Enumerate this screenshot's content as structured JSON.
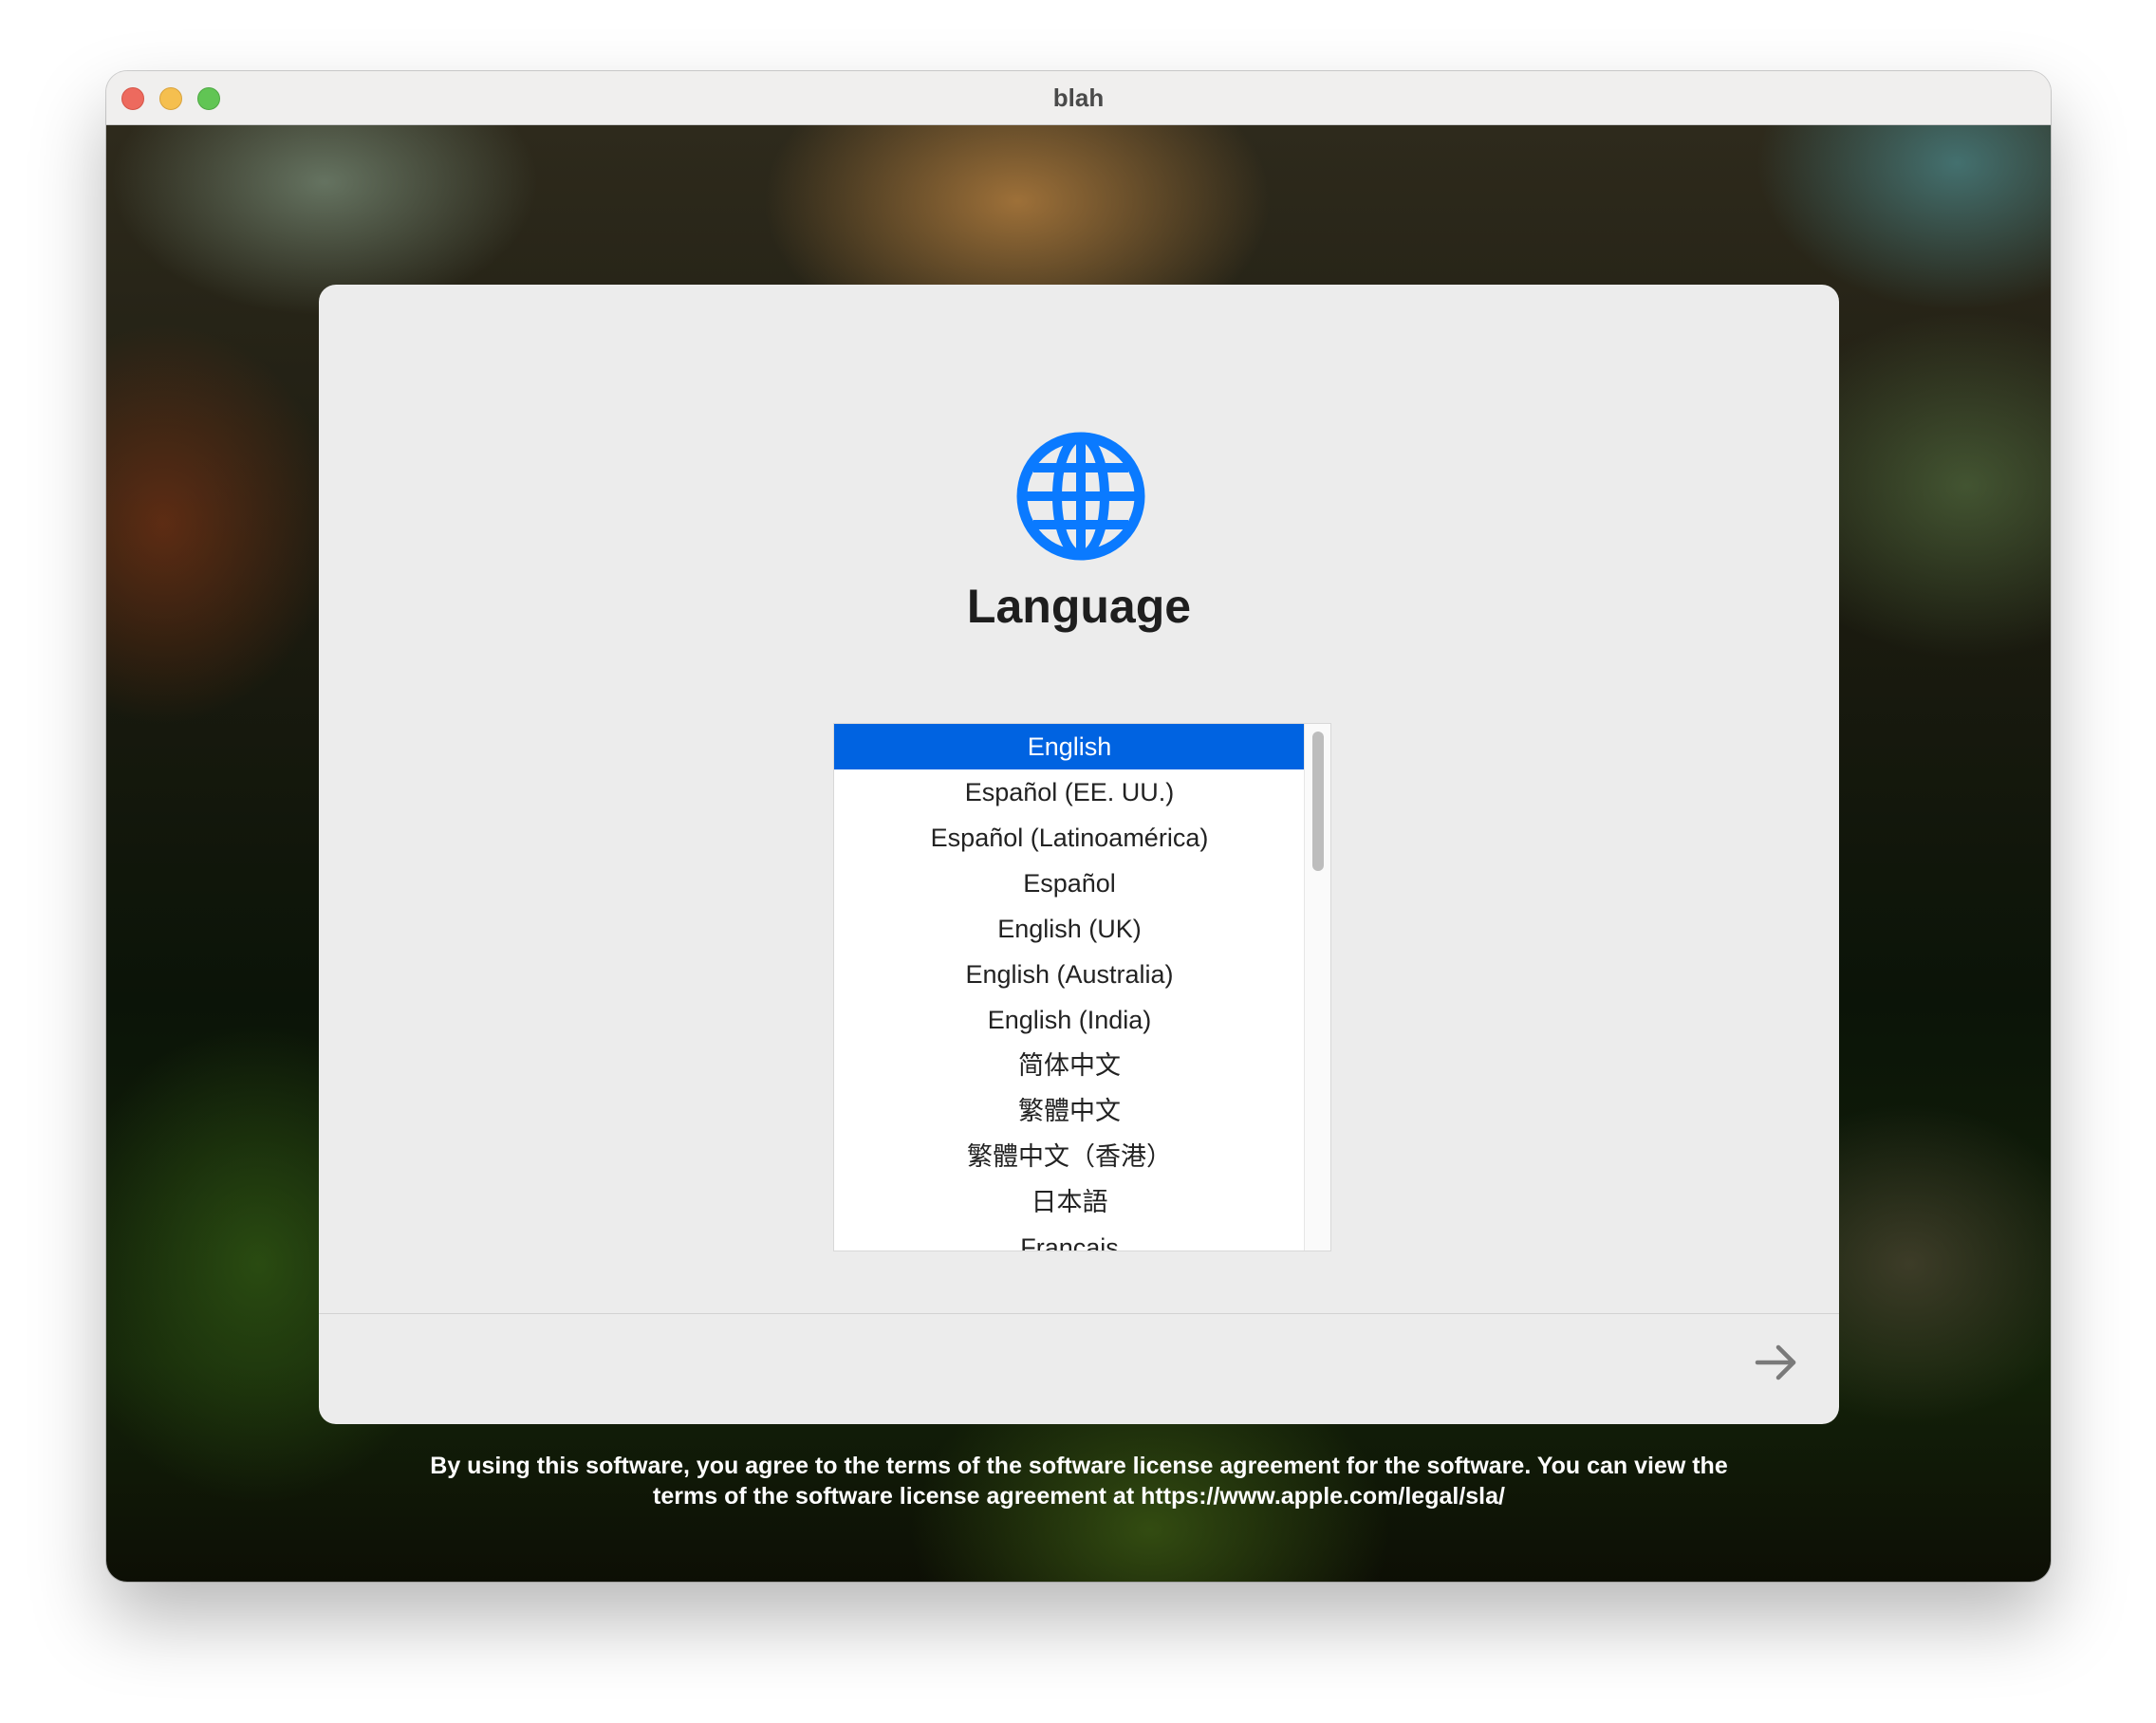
{
  "window": {
    "title": "blah",
    "traffic_lights": {
      "close": "#ed6a5e",
      "minimize": "#f5bf4f",
      "maximize": "#61c554"
    }
  },
  "setup": {
    "icon": "globe-icon",
    "heading": "Language",
    "languages": [
      "English",
      "Español (EE. UU.)",
      "Español (Latinoamérica)",
      "Español",
      "English (UK)",
      "English (Australia)",
      "English (India)",
      "简体中文",
      "繁體中文",
      "繁體中文（香港）",
      "日本語",
      "Français"
    ],
    "selected": "English",
    "next_icon": "arrow-right-icon"
  },
  "license": {
    "line1": "By using this software, you agree to the terms of the software license agreement for the software. You can view the",
    "line2": "terms of the software license agreement at https://www.apple.com/legal/sla/"
  },
  "colors": {
    "accent": "#0063e1",
    "panel_bg": "#ececec",
    "globe": "#0a7aff"
  }
}
